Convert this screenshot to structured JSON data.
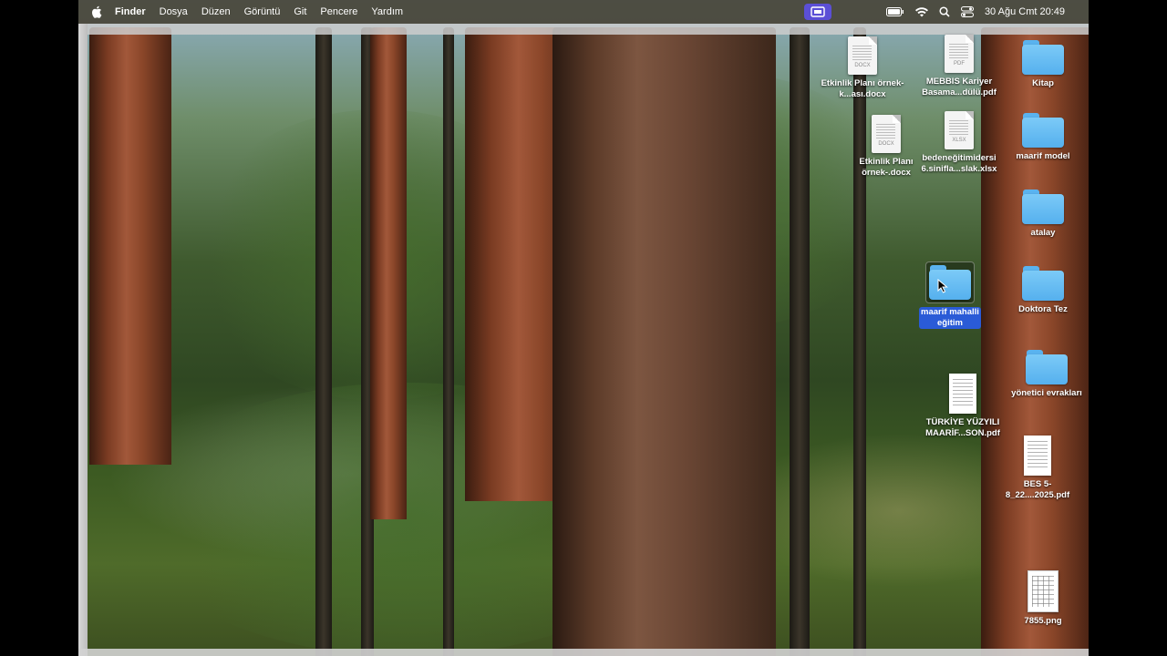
{
  "menubar": {
    "app_name": "Finder",
    "items": [
      "Dosya",
      "Düzen",
      "Görüntü",
      "Git",
      "Pencere",
      "Yardım"
    ],
    "clock": "30 Ağu Cmt  20:49",
    "status_icons": [
      "screen-share-icon",
      "battery-icon",
      "wifi-icon",
      "spotlight-search-icon",
      "control-center-icon"
    ]
  },
  "desktop": {
    "wallpaper": "forest",
    "icons": [
      {
        "label": "Etkinlik Planı örnek- k...ası.docx",
        "type": "docx",
        "ext": "DOCX"
      },
      {
        "label": "MEBBIS Kariyer Basama...dülü.pdf",
        "type": "pdf",
        "ext": "PDF"
      },
      {
        "label": "Kitap",
        "type": "folder"
      },
      {
        "label": "Etkinlik Planı örnek-.docx",
        "type": "docx",
        "ext": "DOCX"
      },
      {
        "label": "bedeneğitimidersi 6.sinifla...slak.xlsx",
        "type": "xlsx",
        "ext": "XLSX"
      },
      {
        "label": "maarif model",
        "type": "folder"
      },
      {
        "label": "atalay",
        "type": "folder"
      },
      {
        "label": "maarif mahalli eğitim",
        "type": "folder",
        "selected": true
      },
      {
        "label": "Doktora Tez",
        "type": "folder"
      },
      {
        "label": "yönetici evrakları",
        "type": "folder"
      },
      {
        "label": "TÜRKİYE YÜZYILI MAARİF...SON.pdf",
        "type": "pdf-thumb"
      },
      {
        "label": "BES 5-8_22....2025.pdf",
        "type": "pdf-thumb"
      },
      {
        "label": "7855.png",
        "type": "png-thumb"
      }
    ]
  },
  "colors": {
    "menubar_bg": "#484437",
    "selection": "#2a5bd7",
    "folder": "#55b0ee",
    "screen_share": "#5b4fd6"
  }
}
